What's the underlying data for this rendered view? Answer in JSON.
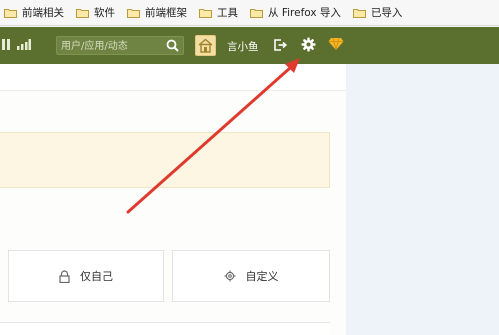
{
  "bookmarks_bar": {
    "items": [
      {
        "label": "前端相关",
        "icon": "folder-icon"
      },
      {
        "label": "软件",
        "icon": "folder-icon"
      },
      {
        "label": "前端框架",
        "icon": "folder-icon"
      },
      {
        "label": "工具",
        "icon": "folder-icon"
      },
      {
        "label": "从 Firefox 导入",
        "icon": "folder-icon"
      },
      {
        "label": "已导入",
        "icon": "folder-icon"
      }
    ]
  },
  "topnav": {
    "background": "#5b6f2f",
    "search": {
      "placeholder": "用户/应用/动态",
      "icon": "search-icon"
    },
    "app_icon": "home-app-icon",
    "username": "言小鱼",
    "logout_icon": "logout-icon",
    "settings_icon": "gear-icon",
    "vip_icon": "gem-icon"
  },
  "panel": {
    "options": [
      {
        "label": "仅自己",
        "icon": "lock-icon"
      },
      {
        "label": "自定义",
        "icon": "gear-icon"
      }
    ]
  },
  "annotation": {
    "arrow_color": "#e03a2f",
    "arrow_target": "gear-icon"
  }
}
